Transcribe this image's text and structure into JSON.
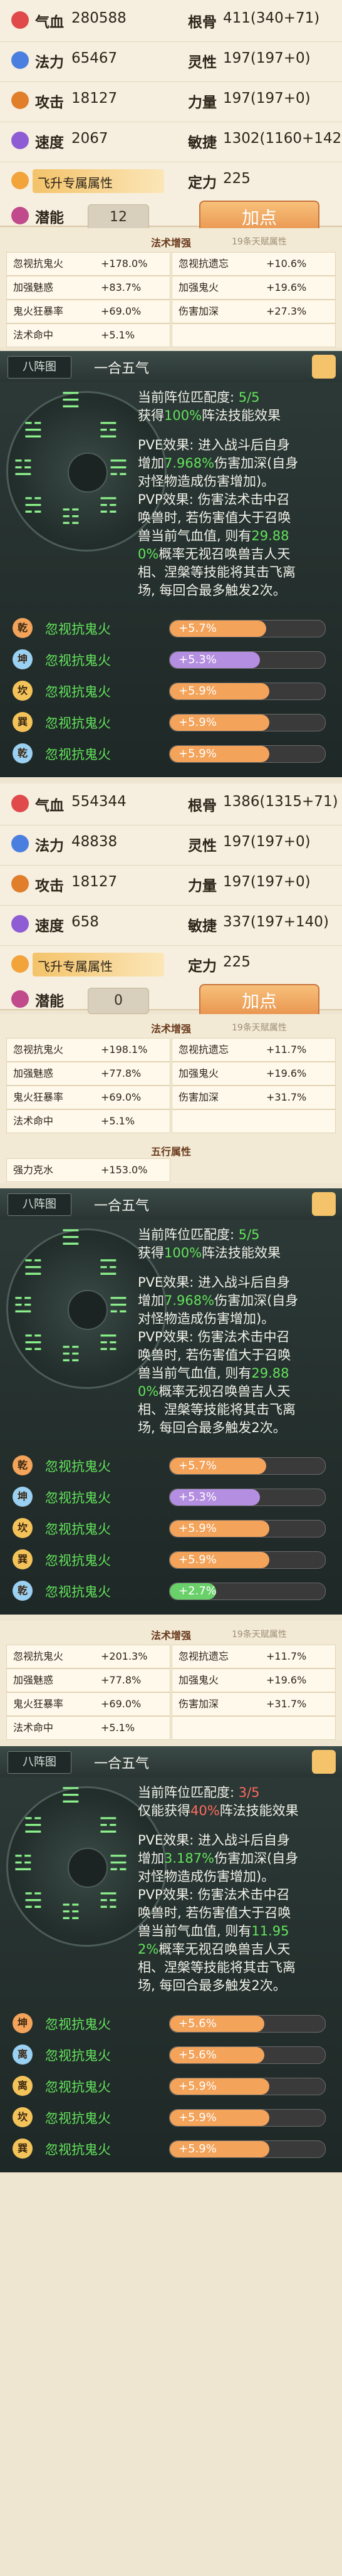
{
  "section1": {
    "rows": [
      [
        {
          "k": "气血",
          "v": "280588",
          "icon": "heart-icon",
          "c": "#e04a4a"
        },
        {
          "k": "根骨",
          "v": "411(340+71)"
        }
      ],
      [
        {
          "k": "法力",
          "v": "65467",
          "icon": "mana-icon",
          "c": "#4a7fe0"
        },
        {
          "k": "灵性",
          "v": "197(197+0)"
        }
      ],
      [
        {
          "k": "攻击",
          "v": "18127",
          "icon": "sword-icon",
          "c": "#e07e2c"
        },
        {
          "k": "力量",
          "v": "197(197+0)"
        }
      ],
      [
        {
          "k": "速度",
          "v": "2067",
          "icon": "boot-icon",
          "c": "#8e5cd4"
        },
        {
          "k": "敏捷",
          "v": "1302(1160+142)"
        }
      ]
    ],
    "attr_feature": {
      "k": "飞升专属属性",
      "v_label": "定力",
      "v": "225"
    },
    "potential": {
      "k": "潜能",
      "v": "12",
      "btn": "加点"
    }
  },
  "boost1": {
    "title": "法术增强",
    "side": "19条天赋属性",
    "cells": [
      [
        "忽视抗鬼火",
        "+178.0%",
        "忽视抗遗忘",
        "+10.6%"
      ],
      [
        "加强魅惑",
        "+83.7%",
        "加强鬼火",
        "+19.6%"
      ],
      [
        "鬼火狂暴率",
        "+69.0%",
        "伤害加深",
        "+27.3%"
      ],
      [
        "法术命中",
        "+5.1%",
        "",
        ""
      ]
    ]
  },
  "formation1": {
    "tab": "八阵图",
    "name": "一合五气",
    "text": [
      {
        "t": "当前阵位匹配度: ",
        "c": "white"
      },
      {
        "t": "5/5",
        "c": "green"
      },
      {
        "t": "获得",
        "c": "white"
      },
      {
        "t": "100%",
        "c": "green"
      },
      {
        "t": "阵法技能效果",
        "c": "white"
      }
    ],
    "pve": [
      "PVE效果: 进入战斗后自身",
      "增加",
      "7.968%",
      "伤害加深(自身",
      "对怪物造成伤害增加)。"
    ],
    "pvp": [
      "PVP效果: 伤害法术击中召",
      "唤兽时, 若伤害值大于召唤",
      "兽当前气血值, 则有",
      "29.88",
      "0%",
      "概率无视召唤兽吉人天",
      "相、涅槃等技能将其击飞离",
      "场, 每回合最多触发2次。"
    ],
    "slots": [
      {
        "badge": "乾",
        "bc": "#f3a35a",
        "name": "忽视抗鬼火",
        "val": "+5.7%",
        "fill": 0.62,
        "color": "#f3a35a"
      },
      {
        "badge": "坤",
        "bc": "#9ad0f2",
        "name": "忽视抗鬼火",
        "val": "+5.3%",
        "fill": 0.58,
        "color": "#b48ee0"
      },
      {
        "badge": "坎",
        "bc": "#f3c35a",
        "name": "忽视抗鬼火",
        "val": "+5.9%",
        "fill": 0.64,
        "color": "#f3a35a"
      },
      {
        "badge": "巽",
        "bc": "#f3c35a",
        "name": "忽视抗鬼火",
        "val": "+5.9%",
        "fill": 0.64,
        "color": "#f3a35a"
      },
      {
        "badge": "乾",
        "bc": "#9ad0f2",
        "name": "忽视抗鬼火",
        "val": "+5.9%",
        "fill": 0.64,
        "color": "#f3a35a"
      }
    ]
  },
  "section2": {
    "rows": [
      [
        {
          "k": "气血",
          "v": "554344",
          "icon": "heart-icon",
          "c": "#e04a4a"
        },
        {
          "k": "根骨",
          "v": "1386(1315+71)"
        }
      ],
      [
        {
          "k": "法力",
          "v": "48838",
          "icon": "mana-icon",
          "c": "#4a7fe0"
        },
        {
          "k": "灵性",
          "v": "197(197+0)"
        }
      ],
      [
        {
          "k": "攻击",
          "v": "18127",
          "icon": "sword-icon",
          "c": "#e07e2c"
        },
        {
          "k": "力量",
          "v": "197(197+0)"
        }
      ],
      [
        {
          "k": "速度",
          "v": "658",
          "icon": "boot-icon",
          "c": "#8e5cd4"
        },
        {
          "k": "敏捷",
          "v": "337(197+140)"
        }
      ]
    ],
    "attr_feature": {
      "k": "飞升专属属性",
      "v_label": "定力",
      "v": "225"
    },
    "potential": {
      "k": "潜能",
      "v": "0",
      "btn": "加点"
    }
  },
  "boost2": {
    "title": "法术增强",
    "side": "19条天赋属性",
    "cells": [
      [
        "忽视抗鬼火",
        "+198.1%",
        "忽视抗遗忘",
        "+11.7%"
      ],
      [
        "加强魅惑",
        "+77.8%",
        "加强鬼火",
        "+19.6%"
      ],
      [
        "鬼火狂暴率",
        "+69.0%",
        "伤害加深",
        "+31.7%"
      ],
      [
        "法术命中",
        "+5.1%",
        "",
        ""
      ]
    ],
    "five_title": "五行属性",
    "five_cells": [
      [
        "强力克水",
        "+153.0%"
      ]
    ]
  },
  "formation2": {
    "tab": "八阵图",
    "name": "一合五气",
    "text": [
      {
        "t": "当前阵位匹配度: ",
        "c": "white"
      },
      {
        "t": "5/5",
        "c": "green"
      },
      {
        "t": "获得",
        "c": "white"
      },
      {
        "t": "100%",
        "c": "green"
      },
      {
        "t": "阵法技能效果",
        "c": "white"
      }
    ],
    "pve": [
      "PVE效果: 进入战斗后自身",
      "增加",
      "7.968%",
      "伤害加深(自身",
      "对怪物造成伤害增加)。"
    ],
    "pvp": [
      "PVP效果: 伤害法术击中召",
      "唤兽时, 若伤害值大于召唤",
      "兽当前气血值, 则有",
      "29.88",
      "0%",
      "概率无视召唤兽吉人天",
      "相、涅槃等技能将其击飞离",
      "场, 每回合最多触发2次。"
    ],
    "slots": [
      {
        "badge": "乾",
        "bc": "#f3a35a",
        "name": "忽视抗鬼火",
        "val": "+5.7%",
        "fill": 0.62,
        "color": "#f3a35a"
      },
      {
        "badge": "坤",
        "bc": "#9ad0f2",
        "name": "忽视抗鬼火",
        "val": "+5.3%",
        "fill": 0.58,
        "color": "#b48ee0"
      },
      {
        "badge": "坎",
        "bc": "#f3c35a",
        "name": "忽视抗鬼火",
        "val": "+5.9%",
        "fill": 0.64,
        "color": "#f3a35a"
      },
      {
        "badge": "巽",
        "bc": "#f3c35a",
        "name": "忽视抗鬼火",
        "val": "+5.9%",
        "fill": 0.64,
        "color": "#f3a35a"
      },
      {
        "badge": "乾",
        "bc": "#9ad0f2",
        "name": "忽视抗鬼火",
        "val": "+2.7%",
        "fill": 0.3,
        "color": "#6ad06a"
      }
    ]
  },
  "boost3": {
    "title": "法术增强",
    "side": "19条天赋属性",
    "cells": [
      [
        "忽视抗鬼火",
        "+201.3%",
        "忽视抗遗忘",
        "+11.7%"
      ],
      [
        "加强魅惑",
        "+77.8%",
        "加强鬼火",
        "+19.6%"
      ],
      [
        "鬼火狂暴率",
        "+69.0%",
        "伤害加深",
        "+31.7%"
      ],
      [
        "法术命中",
        "+5.1%",
        "",
        ""
      ]
    ]
  },
  "formation3": {
    "tab": "八阵图",
    "name": "一合五气",
    "text": [
      {
        "t": "当前阵位匹配度: ",
        "c": "white"
      },
      {
        "t": "3/5",
        "c": "red"
      },
      {
        "t": "仅能获得",
        "c": "white"
      },
      {
        "t": "40%",
        "c": "red"
      },
      {
        "t": "阵法技能效果",
        "c": "white"
      }
    ],
    "pve": [
      "PVE效果: 进入战斗后自身",
      "增加",
      "3.187%",
      "伤害加深(自身",
      "对怪物造成伤害增加)。"
    ],
    "pvp": [
      "PVP效果: 伤害法术击中召",
      "唤兽时, 若伤害值大于召唤",
      "兽当前气血值, 则有",
      "11.95",
      "2%",
      "概率无视召唤兽吉人天",
      "相、涅槃等技能将其击飞离",
      "场, 每回合最多触发2次。"
    ],
    "slots": [
      {
        "badge": "坤",
        "bc": "#f3a35a",
        "name": "忽视抗鬼火",
        "val": "+5.6%",
        "fill": 0.61,
        "color": "#f3a35a"
      },
      {
        "badge": "离",
        "bc": "#9ad0f2",
        "name": "忽视抗鬼火",
        "val": "+5.6%",
        "fill": 0.61,
        "color": "#f3a35a"
      },
      {
        "badge": "离",
        "bc": "#f3c35a",
        "name": "忽视抗鬼火",
        "val": "+5.9%",
        "fill": 0.64,
        "color": "#f3a35a"
      },
      {
        "badge": "坎",
        "bc": "#f3c35a",
        "name": "忽视抗鬼火",
        "val": "+5.9%",
        "fill": 0.64,
        "color": "#f3a35a"
      },
      {
        "badge": "巽",
        "bc": "#f3c35a",
        "name": "忽视抗鬼火",
        "val": "+5.9%",
        "fill": 0.64,
        "color": "#f3a35a"
      }
    ]
  }
}
